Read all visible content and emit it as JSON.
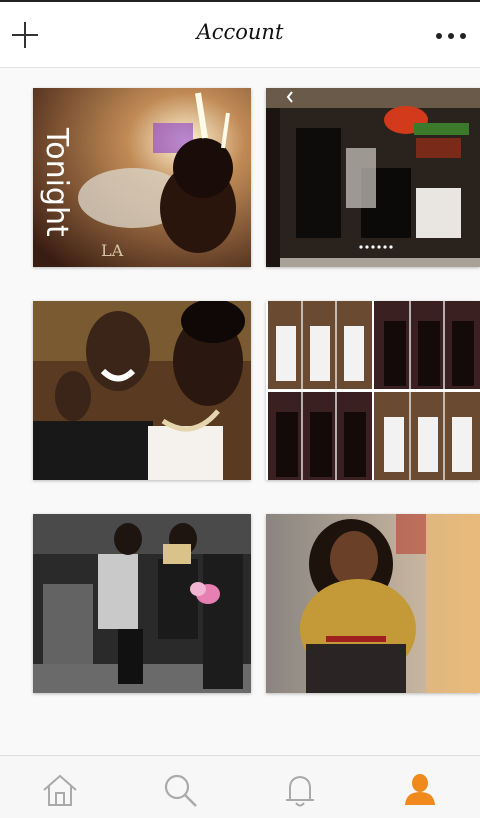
{
  "header": {
    "title": "Account",
    "add_icon": "plus-icon",
    "more_icon": "more-dots-icon"
  },
  "photos": [
    {
      "id": "photo-1",
      "caption": "Tonight",
      "overlay_letter": "LA",
      "theme": "party-sparklers"
    },
    {
      "id": "photo-2",
      "theme": "furniture-store",
      "carousel_dots": 6
    },
    {
      "id": "photo-3",
      "theme": "couple-kiss"
    },
    {
      "id": "photo-4",
      "theme": "collage-grid"
    },
    {
      "id": "photo-5",
      "theme": "airport-selfie"
    },
    {
      "id": "photo-6",
      "theme": "portrait-yellow-top"
    }
  ],
  "tabbar": {
    "items": [
      {
        "name": "home",
        "icon": "home-icon",
        "active": false
      },
      {
        "name": "search",
        "icon": "search-icon",
        "active": false
      },
      {
        "name": "notifications",
        "icon": "bell-icon",
        "active": false
      },
      {
        "name": "profile",
        "icon": "person-icon",
        "active": true
      }
    ]
  },
  "colors": {
    "accent": "#f08a1c",
    "icon_inactive": "#aaaaaa",
    "background": "#f9f9f9"
  }
}
